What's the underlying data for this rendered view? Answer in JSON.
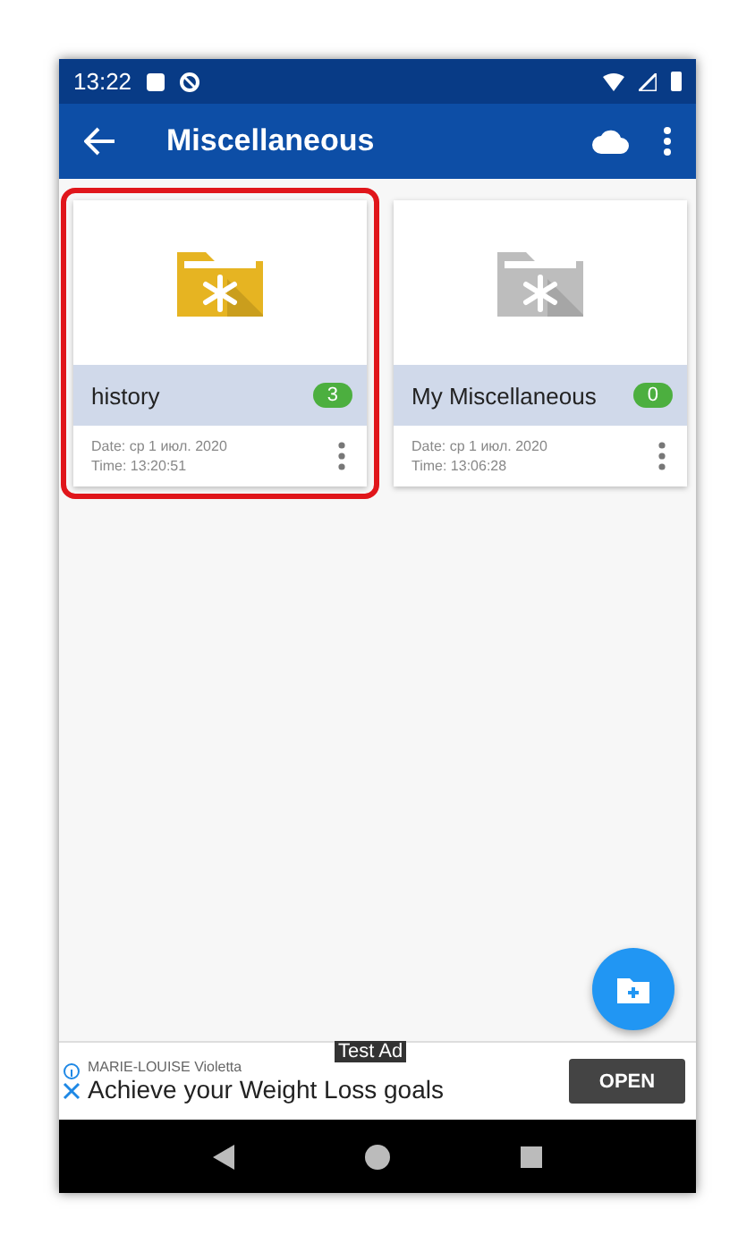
{
  "status_bar": {
    "time": "13:22"
  },
  "app_bar": {
    "title": "Miscellaneous"
  },
  "folders": [
    {
      "name": "history",
      "count": "3",
      "date": "Date: ср 1 июл. 2020",
      "time": "Time:  13:20:51",
      "color": "#e6b422",
      "highlighted": true
    },
    {
      "name": "My Miscellaneous",
      "count": "0",
      "date": "Date: ср 1 июл. 2020",
      "time": "Time:  13:06:28",
      "color": "#bdbdbd",
      "highlighted": false
    }
  ],
  "ad": {
    "advertiser": "MARIE-LOUISE Violetta",
    "badge": "Test Ad",
    "headline": "Achieve your Weight Loss goals",
    "button": "OPEN"
  }
}
